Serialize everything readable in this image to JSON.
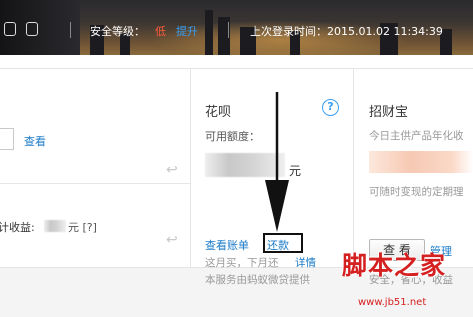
{
  "header": {
    "security_label": "安全等级：",
    "security_level": "低",
    "upgrade_link": "提升",
    "last_login": "上次登录时间：2015.01.02 11:34:39"
  },
  "left_panel": {
    "view_link": "查看",
    "yield_label": "计收益:",
    "yield_unit": "元 [?]"
  },
  "huabei": {
    "title": "花呗",
    "help_symbol": "?",
    "credit_label": "可用额度：",
    "currency_unit": "元",
    "view_bill_link": "查看账单",
    "repay_link": "还款",
    "note_prefix": "这月买，下月还",
    "details_link": "详情",
    "provider_note": "本服务由蚂蚁微贷提供"
  },
  "zhaocaibao": {
    "title": "招财宝",
    "annual_note": "今日主供产品年化收",
    "term_note": "可随时变现的定期理",
    "view_button": "查 看",
    "manage_link": "管理",
    "bottom_note": "安全，省心，收益"
  },
  "watermark": {
    "site_name": "脚本之家",
    "url": "www.jb51.net"
  },
  "colors": {
    "link": "#1a7ac9",
    "danger": "#ff5a3c",
    "accent_blue": "#3a9ff2",
    "watermark": "#d42020"
  }
}
